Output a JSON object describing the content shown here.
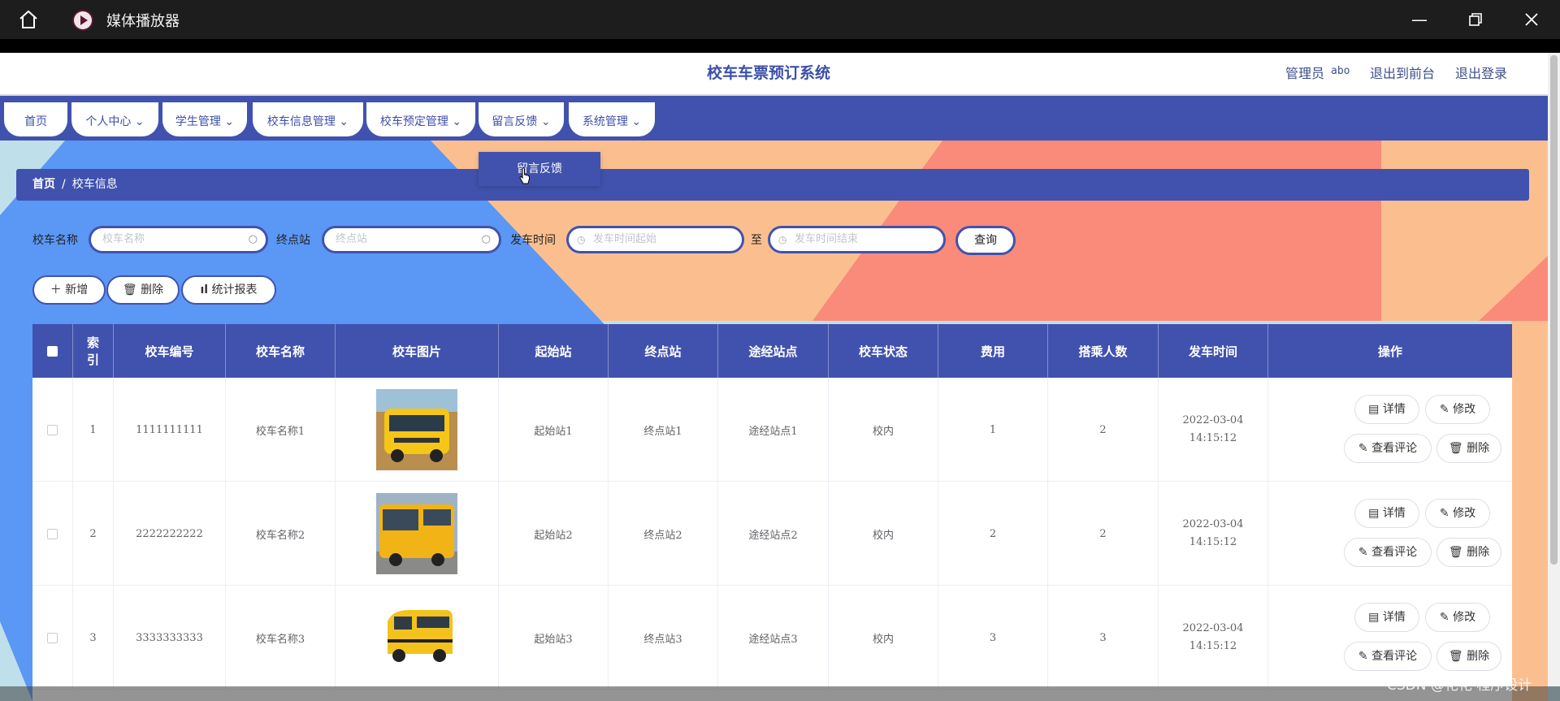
{
  "player": {
    "title": "媒体播放器",
    "icons": [
      "home-icon",
      "minimize-icon",
      "restore-icon",
      "close-icon"
    ]
  },
  "header": {
    "title": "校车车票预订系统",
    "user_role": "管理员",
    "username": "abo",
    "back_link": "退出到前台",
    "logout": "退出登录"
  },
  "nav": {
    "items": [
      {
        "label": "首页"
      },
      {
        "label": "个人中心"
      },
      {
        "label": "学生管理"
      },
      {
        "label": "校车信息管理"
      },
      {
        "label": "校车预定管理"
      },
      {
        "label": "留言反馈"
      },
      {
        "label": "系统管理"
      }
    ],
    "dropdown_item": "留言反馈"
  },
  "breadcrumb": {
    "home": "首页",
    "sep": "/",
    "current": "校车信息"
  },
  "search": {
    "name_label": "校车名称",
    "name_placeholder": "校车名称",
    "end_label": "终点站",
    "end_placeholder": "终点站",
    "time_label": "发车时间",
    "time_start_placeholder": "发车时间起始",
    "time_to": "至",
    "time_end_placeholder": "发车时间结束",
    "query_button": "查询"
  },
  "actions": {
    "add": "新增",
    "delete": "删除",
    "report": "统计报表"
  },
  "table": {
    "headers": {
      "index": "索引",
      "code": "校车编号",
      "name": "校车名称",
      "image": "校车图片",
      "start": "起始站",
      "end": "终点站",
      "via": "途经站点",
      "status": "校车状态",
      "fee": "费用",
      "passengers": "搭乘人数",
      "time": "发车时间",
      "ops": "操作"
    },
    "rows": [
      {
        "index": "1",
        "code": "1111111111",
        "name": "校车名称1",
        "start": "起始站1",
        "end": "终点站1",
        "via": "途经站点1",
        "status": "校内",
        "fee": "1",
        "passengers": "2",
        "time": "2022-03-04 14:15:12"
      },
      {
        "index": "2",
        "code": "2222222222",
        "name": "校车名称2",
        "start": "起始站2",
        "end": "终点站2",
        "via": "途经站点2",
        "status": "校内",
        "fee": "2",
        "passengers": "2",
        "time": "2022-03-04 14:15:12"
      },
      {
        "index": "3",
        "code": "3333333333",
        "name": "校车名称3",
        "start": "起始站3",
        "end": "终点站3",
        "via": "途经站点3",
        "status": "校内",
        "fee": "3",
        "passengers": "3",
        "time": "2022-03-04 14:15:12"
      }
    ],
    "ops": {
      "detail": "详情",
      "edit": "修改",
      "comments": "查看评论",
      "delete": "删除"
    }
  },
  "watermark": "CSDN @花花 程序设计",
  "colors": {
    "primary": "#4152ae",
    "bg_blue": "#5b97f5",
    "bg_peach": "#fbbf8f",
    "bg_coral": "#fa8a7a"
  }
}
